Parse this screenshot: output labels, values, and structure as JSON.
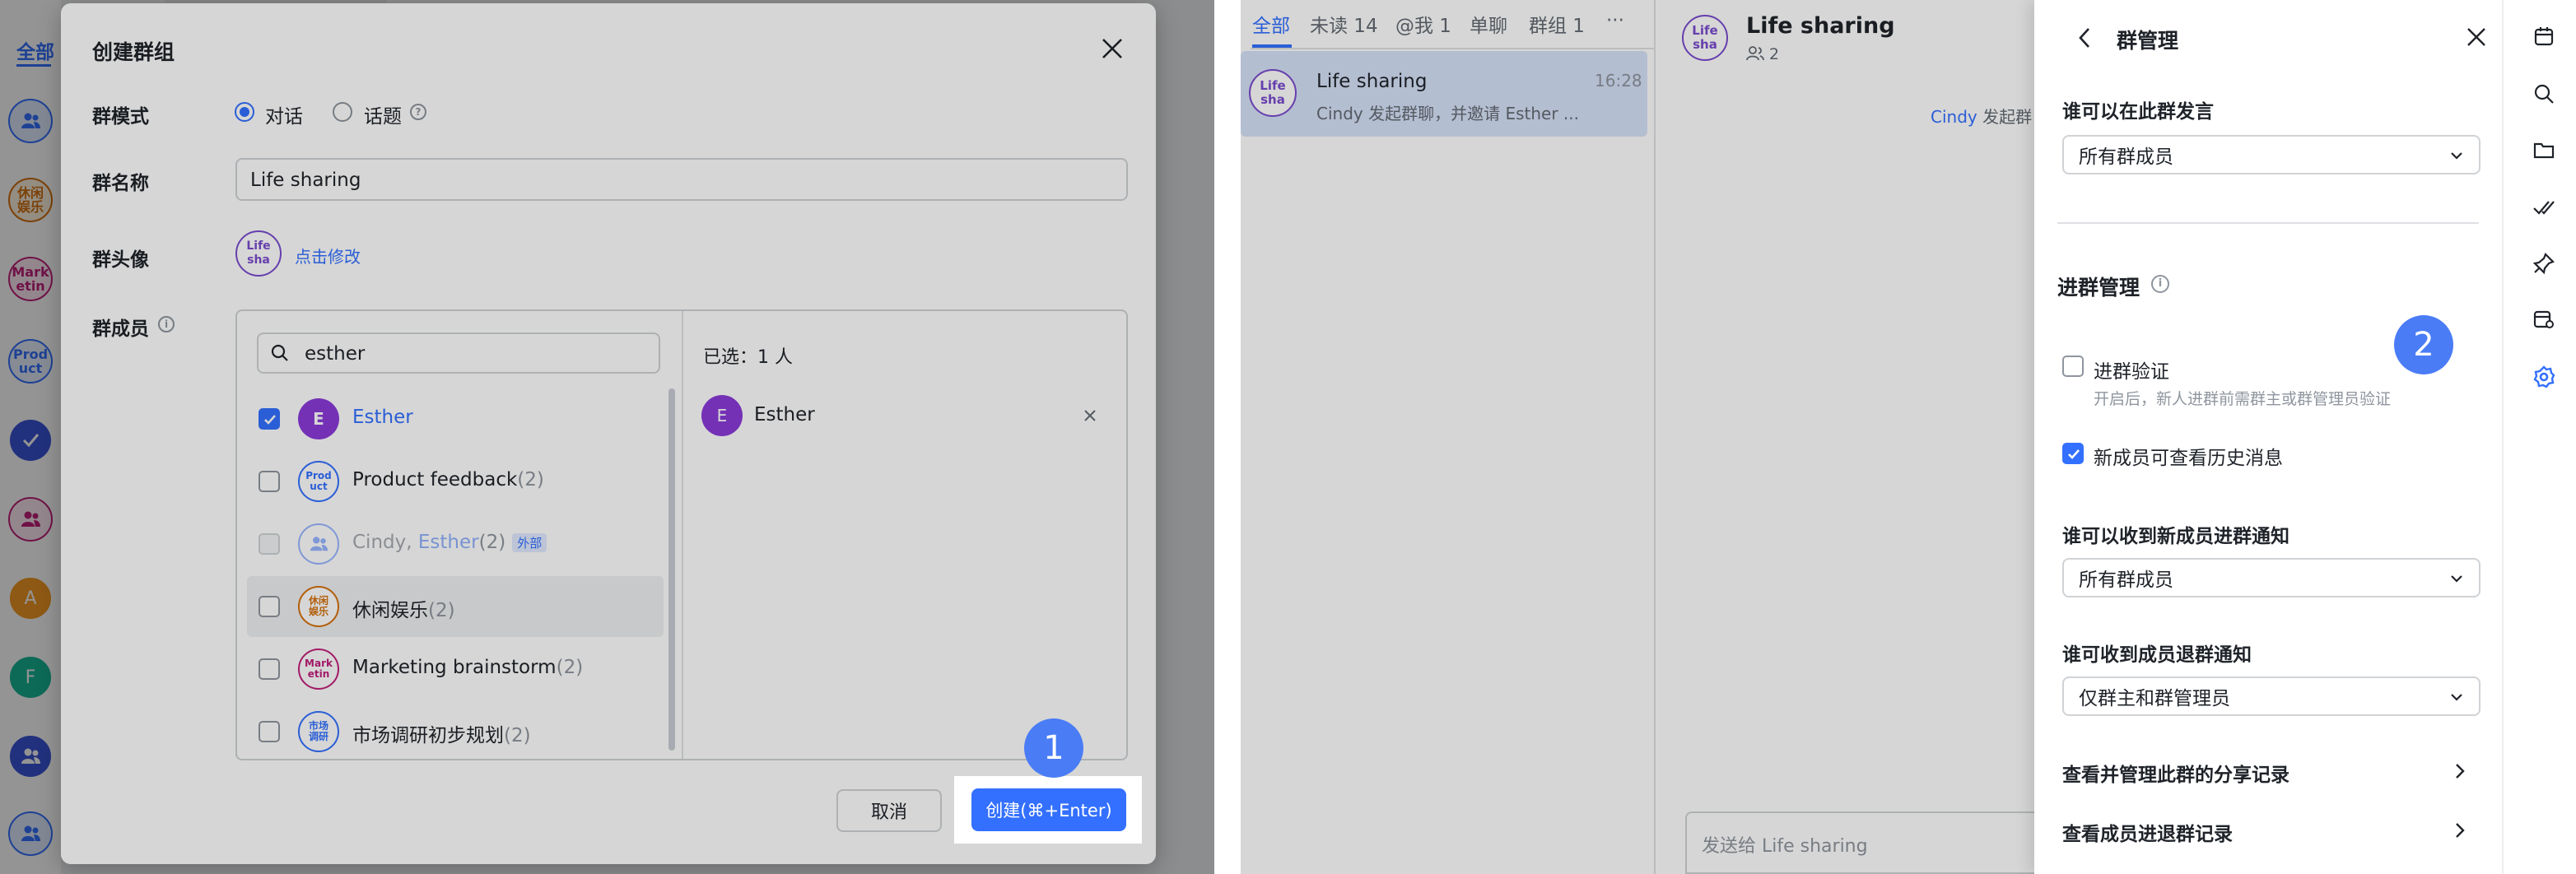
{
  "left": {
    "sidebar_tab": "全部",
    "sidebar_avatars": [
      {
        "text": "",
        "color": "#3370ff",
        "bg": "#e1eaff",
        "icon": "group-icon"
      },
      {
        "text": "休闲\n娱乐",
        "color": "#d5710d",
        "bg": "#fff3e0"
      },
      {
        "text": "Mark\netin",
        "color": "#c1207a",
        "bg": "#fde8f3"
      },
      {
        "text": "Prod\nuct",
        "color": "#3370ff",
        "bg": "#e8efff"
      },
      {
        "text": "",
        "color": "#fff",
        "bg": "#3b55d9",
        "icon": "check-icon"
      },
      {
        "text": "",
        "color": "#c1207a",
        "bg": "#fde8f3",
        "icon": "group-icon"
      },
      {
        "text": "A",
        "color": "#fff",
        "bg": "#f59a23"
      },
      {
        "text": "F",
        "color": "#fff",
        "bg": "#18b797"
      },
      {
        "text": "",
        "color": "#fff",
        "bg": "#3b55d9",
        "icon": "group-icon"
      },
      {
        "text": "",
        "color": "#3370ff",
        "bg": "#e1eaff",
        "icon": "group-icon"
      }
    ],
    "dialog": {
      "title": "创建群组",
      "mode_label": "群模式",
      "mode_options": [
        "对话",
        "话题"
      ],
      "name_label": "群名称",
      "name_value": "Life sharing",
      "avatar_label": "群头像",
      "avatar_text": "Life\nsha",
      "avatar_edit": "点击修改",
      "members_label": "群成员",
      "search_value": "esther",
      "members": [
        {
          "name": "Esther",
          "count": "",
          "checked": true,
          "avatar": "E",
          "avatar_bg": "#8b3bd9",
          "avatar_color": "#fff",
          "highlight": true
        },
        {
          "name": "Product feedback",
          "count": "(2)",
          "checked": false,
          "avatar": "Prod\nuct",
          "avatar_bg": "#fff",
          "avatar_color": "#3370ff"
        },
        {
          "name": "Cindy, ",
          "name2": "Esther",
          "count": "(2)",
          "checked": false,
          "disabled": true,
          "avatar": "",
          "avatar_bg": "#fff",
          "avatar_color": "#3370ff",
          "tag": "外部"
        },
        {
          "name": "休闲娱乐",
          "count": "(2)",
          "checked": false,
          "avatar": "休闲\n娱乐",
          "avatar_bg": "#fff",
          "avatar_color": "#d5710d",
          "hover": true
        },
        {
          "name": "Marketing brainstorm",
          "count": "(2)",
          "checked": false,
          "avatar": "Mark\netin",
          "avatar_bg": "#fff",
          "avatar_color": "#c1207a"
        },
        {
          "name": "市场调研初步规划",
          "count": "(2)",
          "checked": false,
          "avatar": "市场\n调研",
          "avatar_bg": "#fff",
          "avatar_color": "#3370ff"
        }
      ],
      "selected_title": "已选：1 人",
      "selected_name": "Esther",
      "selected_avatar": "E",
      "cancel_label": "取消",
      "create_label": "创建(⌘+Enter)"
    },
    "step_badge": "1"
  },
  "right": {
    "chat_tabs": [
      {
        "label": "全部",
        "active": true
      },
      {
        "label": "未读 14"
      },
      {
        "label": "@我 1"
      },
      {
        "label": "单聊"
      },
      {
        "label": "群组 1"
      },
      {
        "label": "···"
      }
    ],
    "chat_item": {
      "avatar": "Life\nsha",
      "name": "Life sharing",
      "time": "16:28",
      "preview": "Cindy 发起群聊，并邀请 Esther ..."
    },
    "chat_header": {
      "avatar": "Life\nsha",
      "title": "Life sharing",
      "member_count": "2"
    },
    "system_msg_name": "Cindy",
    "system_msg_text": " 发起群",
    "composer_placeholder": "发送给 Life sharing",
    "manage": {
      "title": "群管理",
      "who_can_speak_label": "谁可以在此群发言",
      "who_can_speak_value": "所有群成员",
      "join_section": "进群管理",
      "join_verify_label": "进群验证",
      "join_verify_desc": "开启后，新人进群前需群主或群管理员验证",
      "history_label": "新成员可查看历史消息",
      "join_notify_label": "谁可以收到新成员进群通知",
      "join_notify_value": "所有群成员",
      "leave_notify_label": "谁可收到成员退群通知",
      "leave_notify_value": "仅群主和群管理员",
      "share_records": "查看并管理此群的分享记录",
      "join_records": "查看成员进退群记录"
    },
    "step_badge": "2",
    "right_sidebar_icons": [
      "calendar-icon",
      "search-icon",
      "folder-icon",
      "double-check-icon",
      "pin-icon",
      "calendar-settings-icon",
      "gear-icon"
    ]
  }
}
